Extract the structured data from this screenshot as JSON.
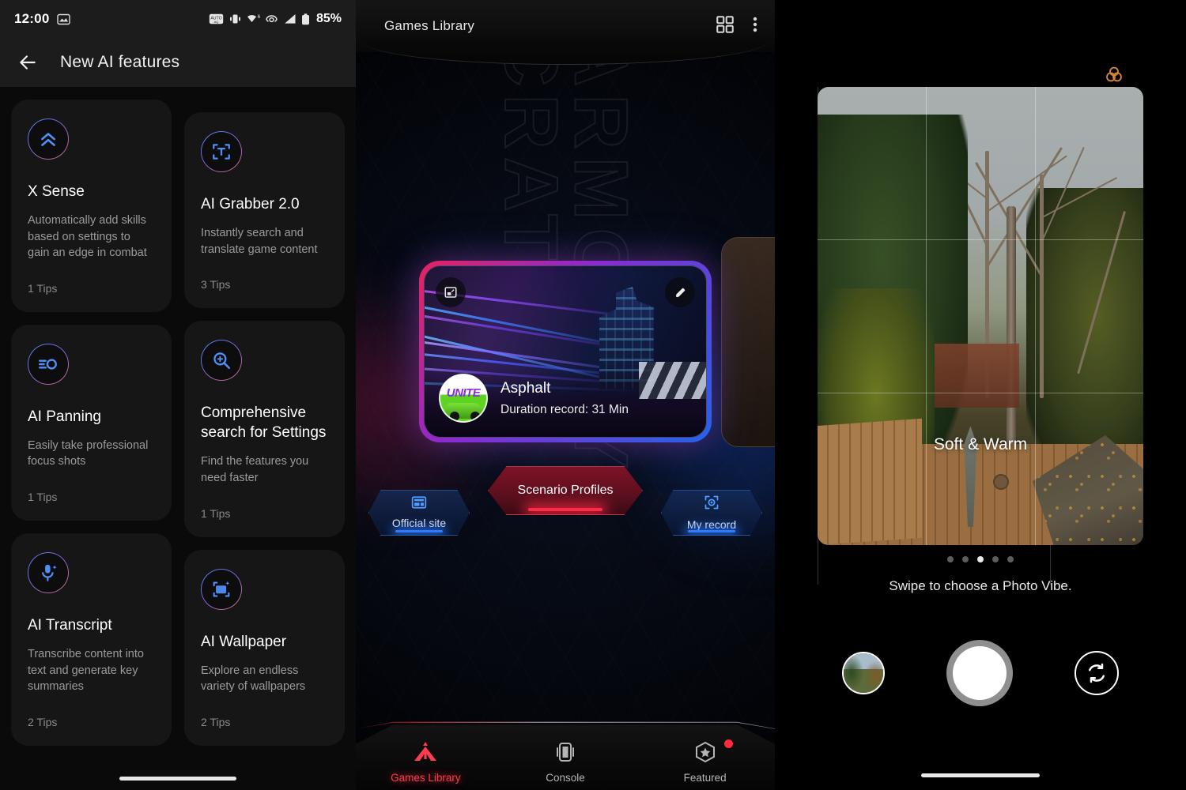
{
  "panel1": {
    "status_bar": {
      "time": "12:00",
      "battery_percent": "85%",
      "icons": [
        "screenshot-icon",
        "auto-rotate-icon",
        "vibrate-icon",
        "wifi-6-icon",
        "sync-icon",
        "signal-icon",
        "battery-icon"
      ]
    },
    "app_bar": {
      "back_label": "back-arrow",
      "title": "New AI features"
    },
    "cards": [
      {
        "icon": "chevrons-up-icon",
        "title": "X Sense",
        "desc": "Automatically add skills based on settings to gain an edge in combat",
        "tips": "1 Tips"
      },
      {
        "icon": "text-grab-icon",
        "title": "AI Grabber 2.0",
        "desc": "Instantly search and translate game content",
        "tips": "3 Tips"
      },
      {
        "icon": "panning-icon",
        "title": "AI Panning",
        "desc": "Easily take professional focus shots",
        "tips": "1 Tips"
      },
      {
        "icon": "search-plus-icon",
        "title": "Comprehensive search for Settings",
        "desc": "Find the features you need faster",
        "tips": "1 Tips"
      },
      {
        "icon": "microphone-sparkle-icon",
        "title": "AI Transcript",
        "desc": "Transcribe content into text and generate key summaries",
        "tips": "2 Tips"
      },
      {
        "icon": "image-sparkle-icon",
        "title": "AI Wallpaper",
        "desc": "Explore an endless variety of wallpapers",
        "tips": "2 Tips"
      }
    ]
  },
  "panel2": {
    "top_bar": {
      "title": "Games Library",
      "grid_icon": "grid-view-icon",
      "menu_icon": "overflow-menu-icon"
    },
    "watermark": "ARMOURY CRATE",
    "game_card": {
      "name": "Asphalt",
      "duration": "Duration record: 31 Min",
      "avatar_text": "UNITE",
      "expand_icon": "fullscreen-icon",
      "edit_icon": "pencil-icon"
    },
    "actions": {
      "primary": {
        "label": "Scenario Profiles"
      },
      "left": {
        "label": "Official site",
        "icon": "web-page-icon"
      },
      "right": {
        "label": "My record",
        "icon": "record-target-icon"
      }
    },
    "nav": [
      {
        "label": "Games Library",
        "icon": "armoury-logo-icon",
        "active": true,
        "badge": false
      },
      {
        "label": "Console",
        "icon": "console-icon",
        "active": false,
        "badge": false
      },
      {
        "label": "Featured",
        "icon": "star-hex-icon",
        "active": false,
        "badge": true
      }
    ],
    "colors": {
      "accent_red": "#ff3b4e",
      "accent_blue": "#2f7bff"
    }
  },
  "panel3": {
    "filter_icon": "color-filter-icon",
    "filter_icon_color": "#d9883a",
    "vibe_label": "Soft & Warm",
    "hint": "Swipe to choose a Photo Vibe.",
    "dots": {
      "count": 5,
      "active_index": 2
    },
    "controls": {
      "gallery": "gallery-thumbnail",
      "shutter": "shutter-button",
      "flip": "flip-camera-icon"
    }
  }
}
